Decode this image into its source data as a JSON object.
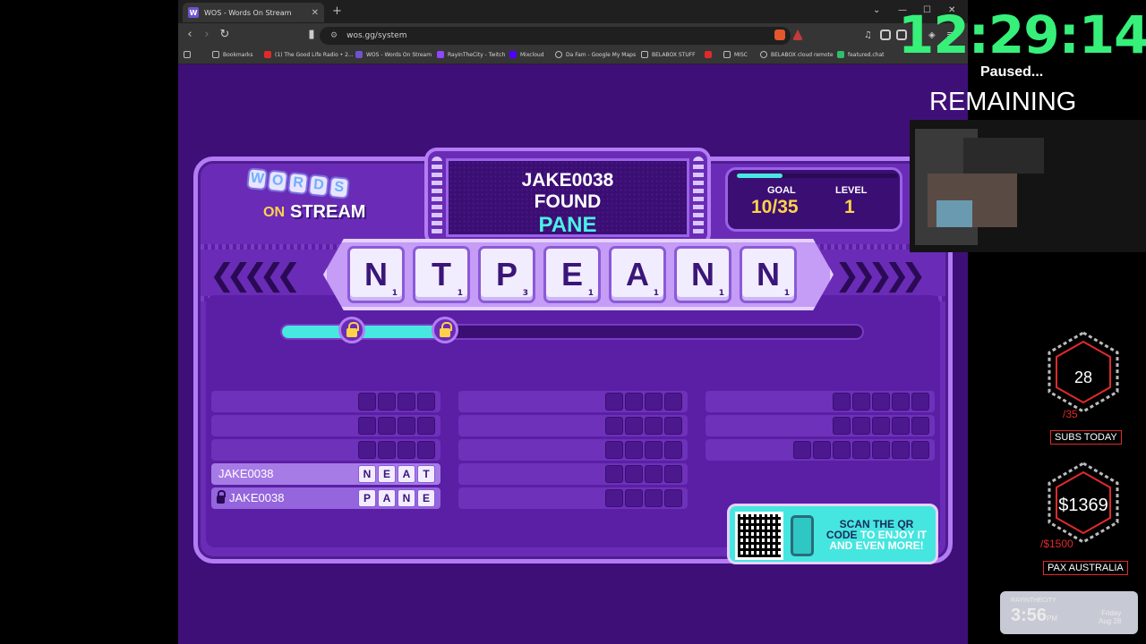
{
  "browser": {
    "tab_title": "WOS - Words On Stream",
    "tab_favicon_letter": "W",
    "url": "wos.gg/system",
    "bookmarks": [
      "Bookmarks",
      "(1) The Good Life Radio • 2...",
      "WOS - Words On Stream",
      "RayInTheCity - Twitch",
      "Mixcloud",
      "Da Fam - Google My Maps",
      "BELABOX STUFF",
      "MISC",
      "BELABOX cloud remote",
      "featured.chat"
    ]
  },
  "game": {
    "logo_words": "WORDS",
    "logo_on": "ON",
    "logo_stream": "STREAM",
    "found_player": "JAKE0038",
    "found_label": "FOUND",
    "found_word": "PANE",
    "goal_label": "GOAL",
    "goal_value": "10/35",
    "goal_progress": 0.2857,
    "level_label": "LEVEL",
    "level_value": "1",
    "tiles": [
      {
        "letter": "N",
        "value": "1"
      },
      {
        "letter": "T",
        "value": "1"
      },
      {
        "letter": "P",
        "value": "3"
      },
      {
        "letter": "E",
        "value": "1"
      },
      {
        "letter": "A",
        "value": "1"
      },
      {
        "letter": "N",
        "value": "1"
      },
      {
        "letter": "N",
        "value": "1"
      }
    ],
    "timer_progress": 0.28,
    "col1": [
      {
        "name": "",
        "letters": [
          "",
          "",
          "",
          ""
        ]
      },
      {
        "name": "",
        "letters": [
          "",
          "",
          "",
          ""
        ]
      },
      {
        "name": "",
        "letters": [
          "",
          "",
          "",
          ""
        ]
      },
      {
        "name": "JAKE0038",
        "letters": [
          "N",
          "E",
          "A",
          "T"
        ]
      },
      {
        "name": "JAKE0038",
        "letters": [
          "P",
          "A",
          "N",
          "E"
        ]
      }
    ],
    "qr_text_1": "SCAN THE QR",
    "qr_text_2": "CODE",
    "qr_text_3": "TO ENJOY IT",
    "qr_text_4": "AND EVEN MORE!"
  },
  "overlay": {
    "clock": "12:29:14",
    "paused": "Paused...",
    "remaining": "REMAINING",
    "subs_value": "28",
    "subs_goal": "/35",
    "subs_label": "SUBS TODAY",
    "pax_value": "$1369",
    "pax_goal": "/$1500",
    "pax_label": "PAX AUSTRALIA",
    "widget_name": "RAYINTHECITY",
    "widget_time": "3:56",
    "widget_ampm": "PM",
    "widget_day": "Friday",
    "widget_date": "Aug 28"
  },
  "colors": {
    "accent_cyan": "#47e8e0",
    "clock_green": "#36f07a",
    "gold": "#ffd24a",
    "alert_red": "#e02a2a",
    "board_purple": "#6a2cb6"
  }
}
